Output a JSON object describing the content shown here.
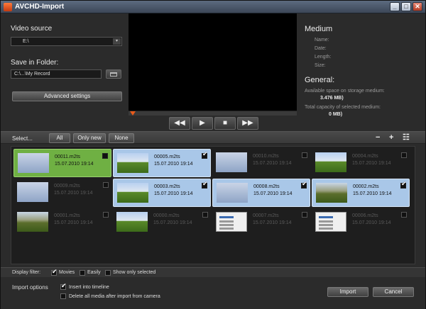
{
  "window": {
    "title": "AVCHD-Import",
    "minimize": "_",
    "maximize": "□",
    "close": "✕"
  },
  "source": {
    "label": "Video source",
    "value": "E:\\",
    "dropdown_arrow": "▾"
  },
  "save": {
    "label": "Save in Folder:",
    "value": "C:\\...\\My Record"
  },
  "advanced_label": "Advanced settings",
  "transport": {
    "rewind": "◀◀",
    "play": "▶",
    "stop": "■",
    "forward": "▶▶"
  },
  "medium": {
    "heading": "Medium",
    "name_label": "Name:",
    "date_label": "Date:",
    "length_label": "Length:",
    "size_label": "Size:"
  },
  "general": {
    "heading": "General:",
    "available_label": "Available space on storage medium:",
    "available_value": "3.476 MB)",
    "capacity_label": "Total capacity of selected medium:",
    "capacity_value": "0 MB)"
  },
  "selection": {
    "select_label": "Select...",
    "all": "All",
    "only_new": "Only new",
    "none": "None",
    "minus": "−",
    "plus": "+",
    "list_view": "☷"
  },
  "clips": [
    {
      "name": "00011.m2ts",
      "date": "15.07.2010 19:14",
      "checked": false,
      "state": "current",
      "thumb": "screen"
    },
    {
      "name": "00005.m2ts",
      "date": "15.07.2010 19:14",
      "checked": true,
      "state": "selected",
      "thumb": "field"
    },
    {
      "name": "00010.m2ts",
      "date": "15.07.2010 19:14",
      "checked": false,
      "state": "plain",
      "thumb": "screen"
    },
    {
      "name": "00004.m2ts",
      "date": "15.07.2010 19:14",
      "checked": false,
      "state": "plain",
      "thumb": "field"
    },
    {
      "name": "00009.m2ts",
      "date": "15.07.2010 19:14",
      "checked": false,
      "state": "plain",
      "thumb": "screen"
    },
    {
      "name": "00003.m2ts",
      "date": "15.07.2010 19:14",
      "checked": true,
      "state": "selected",
      "thumb": "field"
    },
    {
      "name": "00008.m2ts",
      "date": "15.07.2010 19:14",
      "checked": true,
      "state": "selected",
      "thumb": "screen"
    },
    {
      "name": "00002.m2ts",
      "date": "15.07.2010 19:14",
      "checked": true,
      "state": "selected",
      "thumb": "trees"
    },
    {
      "name": "00001.m2ts",
      "date": "15.07.2010 19:14",
      "checked": false,
      "state": "plain",
      "thumb": "trees"
    },
    {
      "name": "00000.m2ts",
      "date": "15.07.2010 19:14",
      "checked": false,
      "state": "plain",
      "thumb": "field"
    },
    {
      "name": "00007.m2ts",
      "date": "15.07.2010 19:14",
      "checked": false,
      "state": "plain",
      "thumb": "doc"
    },
    {
      "name": "00006.m2ts",
      "date": "15.07.2010 19:14",
      "checked": false,
      "state": "plain",
      "thumb": "doc"
    }
  ],
  "filter": {
    "label": "Display filter:",
    "movies": "Movies",
    "movies_checked": true,
    "easily": "Easily",
    "easily_checked": false,
    "only_selected": "Show only selected",
    "only_selected_checked": false
  },
  "import_options": {
    "label": "Import options",
    "insert": "Insert into timeline",
    "insert_checked": true,
    "delete": "Delete all media after import from camera",
    "delete_checked": false
  },
  "buttons": {
    "import": "Import",
    "cancel": "Cancel"
  }
}
